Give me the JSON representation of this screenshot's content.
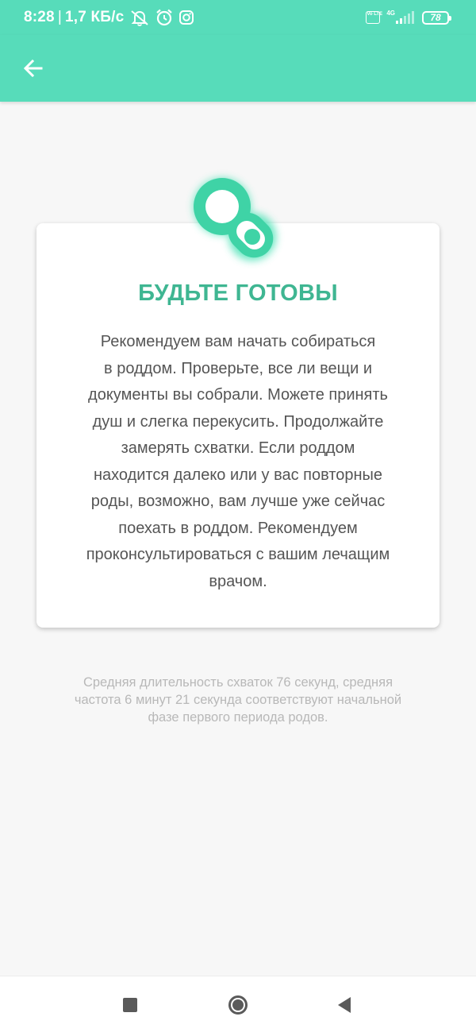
{
  "status_bar": {
    "time": "8:28",
    "separator": "|",
    "speed": "1,7 КБ/с",
    "icons": [
      "muted-notifications-icon",
      "alarm-icon",
      "instagram-icon",
      "volte-icon",
      "signal-4g-icon",
      "battery-icon"
    ],
    "volte_label": "Vo LTE",
    "network": "4G",
    "battery": "78"
  },
  "app_bar": {
    "back_icon": "arrow-left-icon",
    "color": "#57dcba"
  },
  "card": {
    "icon": "pacifier-icon",
    "title": "БУДЬТЕ ГОТОВЫ",
    "body": "Рекомендуем вам начать собираться\nв роддом. Проверьте, все ли вещи и\nдокументы вы собрали. Можете принять\nдуш и слегка перекусить. Продолжайте\nзамерять схватки. Если роддом\nнаходится далеко или у вас повторные\nроды, возможно, вам лучше уже сейчас\nпоехать в роддом. Рекомендуем\nпроконсультироваться с вашим лечащим\nврачом.",
    "accent_color": "#3fb692"
  },
  "stats": {
    "text": "Средняя длительность схваток 76 секунд, средняя\nчастота 6 минут 21 секунда соответствуют начальной\nфазе первого периода родов."
  },
  "nav_bar": {
    "icons": [
      "recent-apps-icon",
      "home-icon",
      "back-triangle-icon"
    ]
  }
}
